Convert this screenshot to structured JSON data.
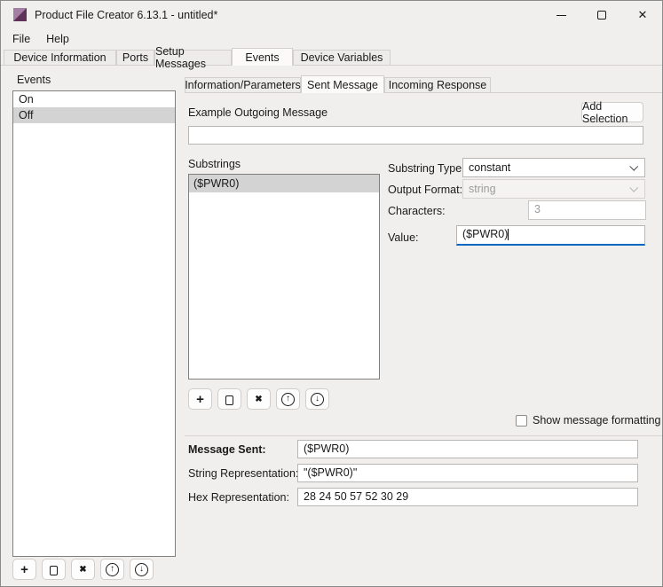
{
  "window": {
    "title": "Product File Creator 6.13.1 - untitled*"
  },
  "icons": {
    "close": "✕",
    "add": "+",
    "delete": "✖",
    "move_up": "↑",
    "move_down": "↓"
  },
  "menu": {
    "items": [
      {
        "label": "File"
      },
      {
        "label": "Help"
      }
    ]
  },
  "tabs": {
    "items": [
      {
        "label": "Device Information",
        "selected": false
      },
      {
        "label": "Ports",
        "selected": false
      },
      {
        "label": "Setup Messages",
        "selected": false
      },
      {
        "label": "Events",
        "selected": true
      },
      {
        "label": "Device Variables",
        "selected": false
      }
    ]
  },
  "events_panel": {
    "title": "Events",
    "items": [
      {
        "label": "On",
        "selected": false
      },
      {
        "label": "Off",
        "selected": true
      }
    ]
  },
  "subtabs": {
    "items": [
      {
        "label": "Information/Parameters",
        "selected": false
      },
      {
        "label": "Sent Message",
        "selected": true
      },
      {
        "label": "Incoming Response",
        "selected": false
      }
    ]
  },
  "sent_message": {
    "example_label": "Example Outgoing Message",
    "example_value": "",
    "add_selection_button": "Add Selection",
    "substrings_label": "Substrings",
    "substrings": [
      {
        "label": "($PWR0)",
        "selected": true
      }
    ],
    "form": {
      "substring_type": {
        "label": "Substring Type:",
        "value": "constant",
        "enabled": true
      },
      "output_format": {
        "label": "Output Format:",
        "value": "string",
        "enabled": false
      },
      "characters": {
        "label": "Characters:",
        "value": "3",
        "enabled": false
      },
      "value": {
        "label": "Value:",
        "value": "($PWR0)",
        "focused": true
      }
    },
    "show_formatting_label": "Show message formatting",
    "show_formatting_checked": false,
    "results": {
      "message_sent": {
        "label": "Message Sent:",
        "value": "($PWR0)"
      },
      "string_representation": {
        "label": "String Representation:",
        "value": "\"($PWR0)\""
      },
      "hex_representation": {
        "label": "Hex Representation:",
        "value": "28 24 50 57 52 30 29"
      }
    }
  },
  "colors": {
    "focus_accent": "#0067c0",
    "selection_inactive": "#d3d3d3",
    "window_bg": "#f1efed",
    "disabled_text": "#9c9c9c"
  }
}
